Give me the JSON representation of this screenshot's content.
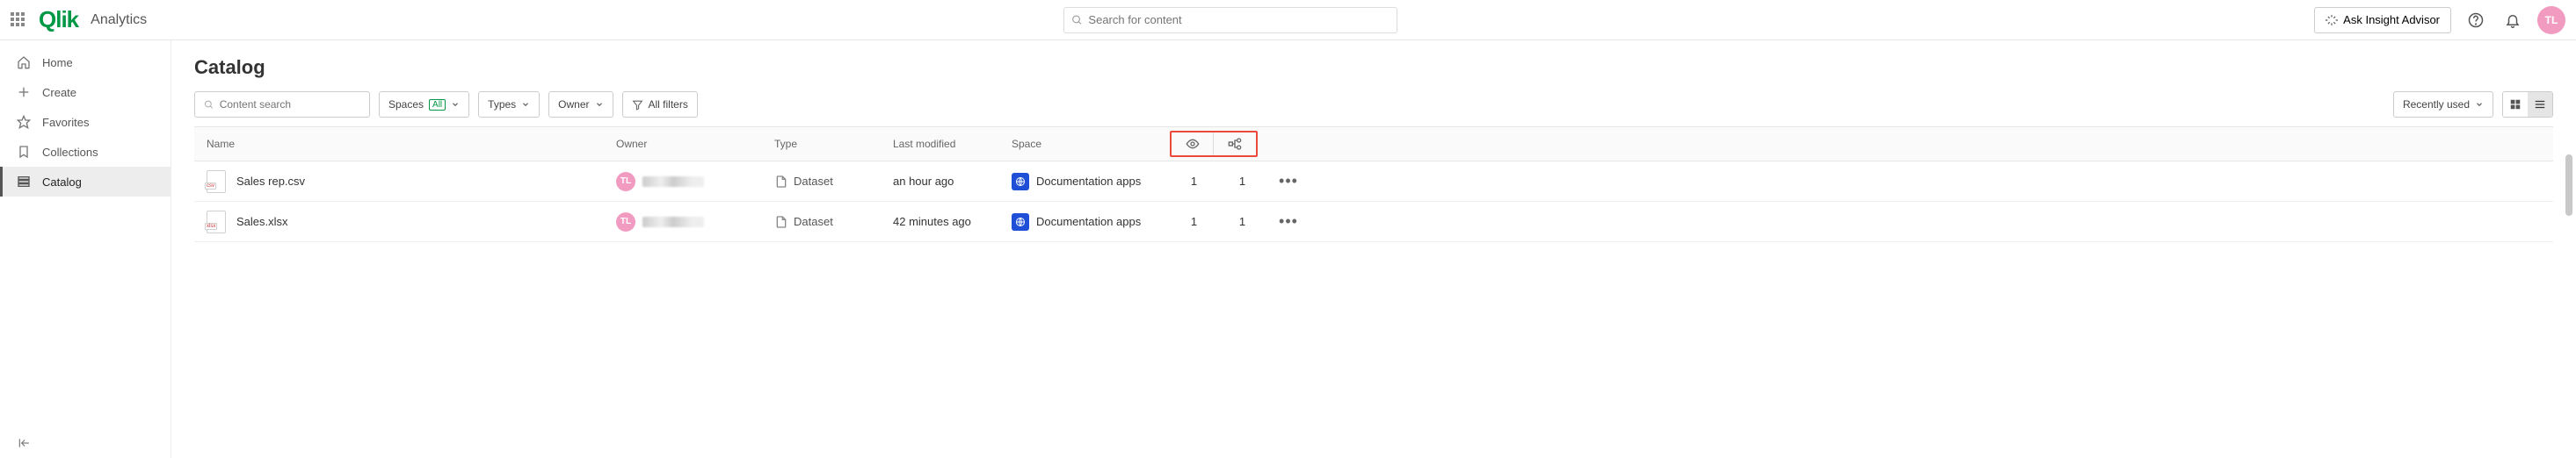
{
  "header": {
    "product": "Qlik",
    "section": "Analytics",
    "search_placeholder": "Search for content",
    "ask_label": "Ask Insight Advisor",
    "avatar_initials": "TL"
  },
  "sidebar": {
    "items": [
      {
        "label": "Home"
      },
      {
        "label": "Create"
      },
      {
        "label": "Favorites"
      },
      {
        "label": "Collections"
      },
      {
        "label": "Catalog"
      }
    ],
    "active_index": 4
  },
  "page": {
    "title": "Catalog",
    "content_search_placeholder": "Content search",
    "filters": {
      "spaces_label": "Spaces",
      "spaces_badge": "All",
      "types_label": "Types",
      "owner_label": "Owner",
      "allfilters_label": "All filters"
    },
    "sort_label": "Recently used"
  },
  "table": {
    "columns": {
      "name": "Name",
      "owner": "Owner",
      "type": "Type",
      "modified": "Last modified",
      "space": "Space"
    },
    "rows": [
      {
        "name": "Sales rep.csv",
        "file_tag": "csv",
        "owner_initials": "TL",
        "type": "Dataset",
        "modified": "an hour ago",
        "space": "Documentation apps",
        "views": "1",
        "used": "1"
      },
      {
        "name": "Sales.xlsx",
        "file_tag": "xlsx",
        "owner_initials": "TL",
        "type": "Dataset",
        "modified": "42 minutes ago",
        "space": "Documentation apps",
        "views": "1",
        "used": "1"
      }
    ]
  }
}
